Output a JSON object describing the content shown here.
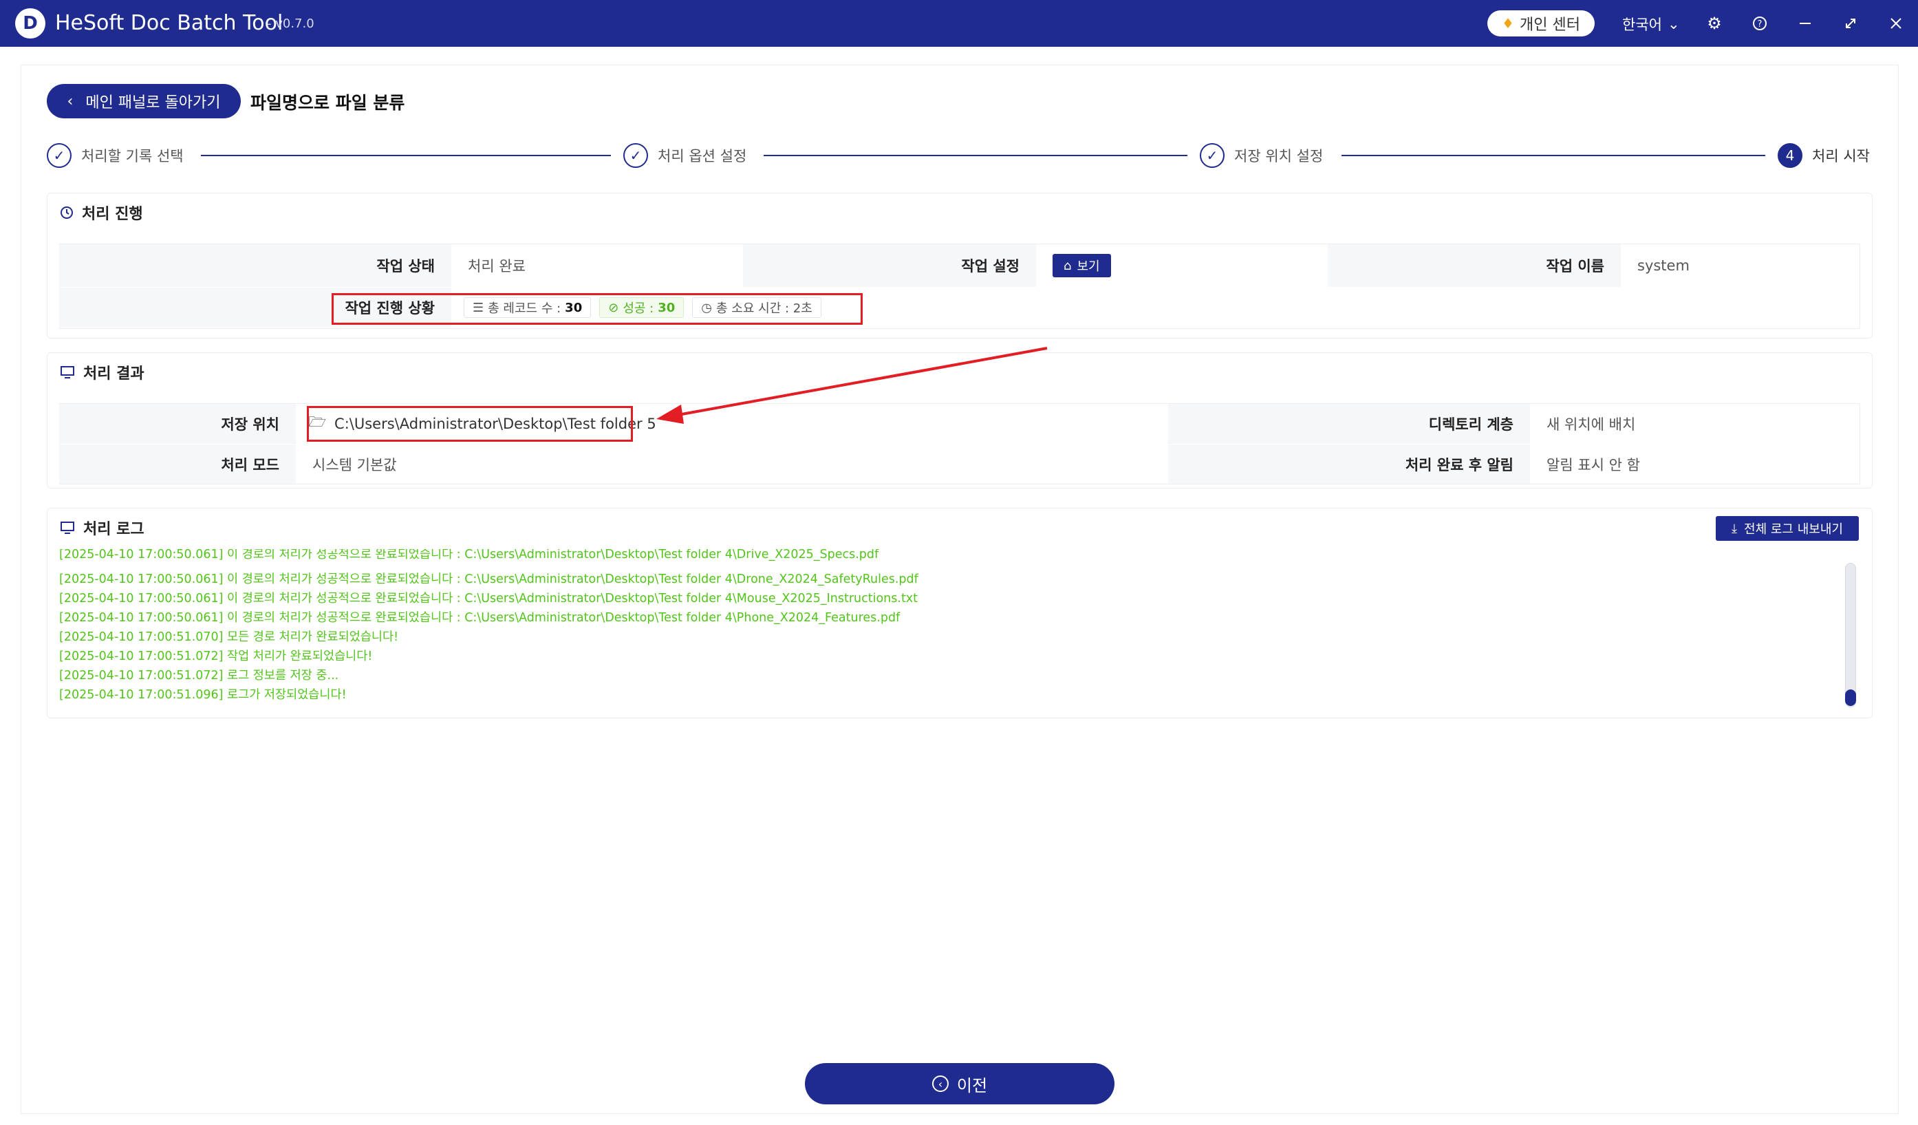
{
  "app": {
    "logo_letter": "D",
    "title": "HeSoft Doc Batch Tool",
    "version": "- v0.7.0",
    "personal_center": "개인 센터",
    "language": "한국어"
  },
  "header": {
    "back_label": "메인 패널로 돌아가기",
    "page_title": "파일명으로 파일 분류"
  },
  "steps": [
    {
      "label": "처리할 기록 선택",
      "state": "done"
    },
    {
      "label": "처리 옵션 설정",
      "state": "done"
    },
    {
      "label": "저장 위치 설정",
      "state": "done"
    },
    {
      "label": "처리 시작",
      "number": "4",
      "state": "active"
    }
  ],
  "progress": {
    "title": "처리 진행",
    "status_label": "작업 상태",
    "status_value": "처리 완료",
    "settings_label": "작업 설정",
    "view_label": "보기",
    "name_label": "작업 이름",
    "name_value": "system",
    "progress_label": "작업 진행 상황",
    "total_records": "총 레코드 수 :",
    "total_records_value": "30",
    "success": "성공 :",
    "success_value": "30",
    "total_time": "총 소요 시간 : 2초"
  },
  "result": {
    "title": "처리 결과",
    "save_location_label": "저장 위치",
    "save_location_value": "C:\\Users\\Administrator\\Desktop\\Test folder 5",
    "dir_level_label": "디렉토리 계층",
    "dir_level_value": "새 위치에 배치",
    "mode_label": "처리 모드",
    "mode_value": "시스템 기본값",
    "notify_label": "처리 완료 후 알림",
    "notify_value": "알림 표시 안 함"
  },
  "log": {
    "title": "처리 로그",
    "export_label": "전체 로그 내보내기",
    "lines": [
      "[2025-04-10 17:00:50.061] 이 경로의 처리가 성공적으로 완료되었습니다 : C:\\Users\\Administrator\\Desktop\\Test folder 4\\Drive_X2025_Specs.pdf",
      "[2025-04-10 17:00:50.061] 이 경로의 처리가 성공적으로 완료되었습니다 : C:\\Users\\Administrator\\Desktop\\Test folder 4\\Drone_X2024_SafetyRules.pdf",
      "[2025-04-10 17:00:50.061] 이 경로의 처리가 성공적으로 완료되었습니다 : C:\\Users\\Administrator\\Desktop\\Test folder 4\\Mouse_X2025_Instructions.txt",
      "[2025-04-10 17:00:50.061] 이 경로의 처리가 성공적으로 완료되었습니다 : C:\\Users\\Administrator\\Desktop\\Test folder 4\\Phone_X2024_Features.pdf",
      "[2025-04-10 17:00:51.070] 모든 경로 처리가 완료되었습니다!",
      "[2025-04-10 17:00:51.072] 작업 처리가 완료되었습니다!",
      "[2025-04-10 17:00:51.072] 로그 정보를 저장 중...",
      "[2025-04-10 17:00:51.096] 로그가 저장되었습니다!"
    ]
  },
  "footer": {
    "prev_label": "이전"
  },
  "colors": {
    "primary": "#1f2b8f",
    "log_green": "#52c41a",
    "highlight_red": "#e31d24"
  }
}
